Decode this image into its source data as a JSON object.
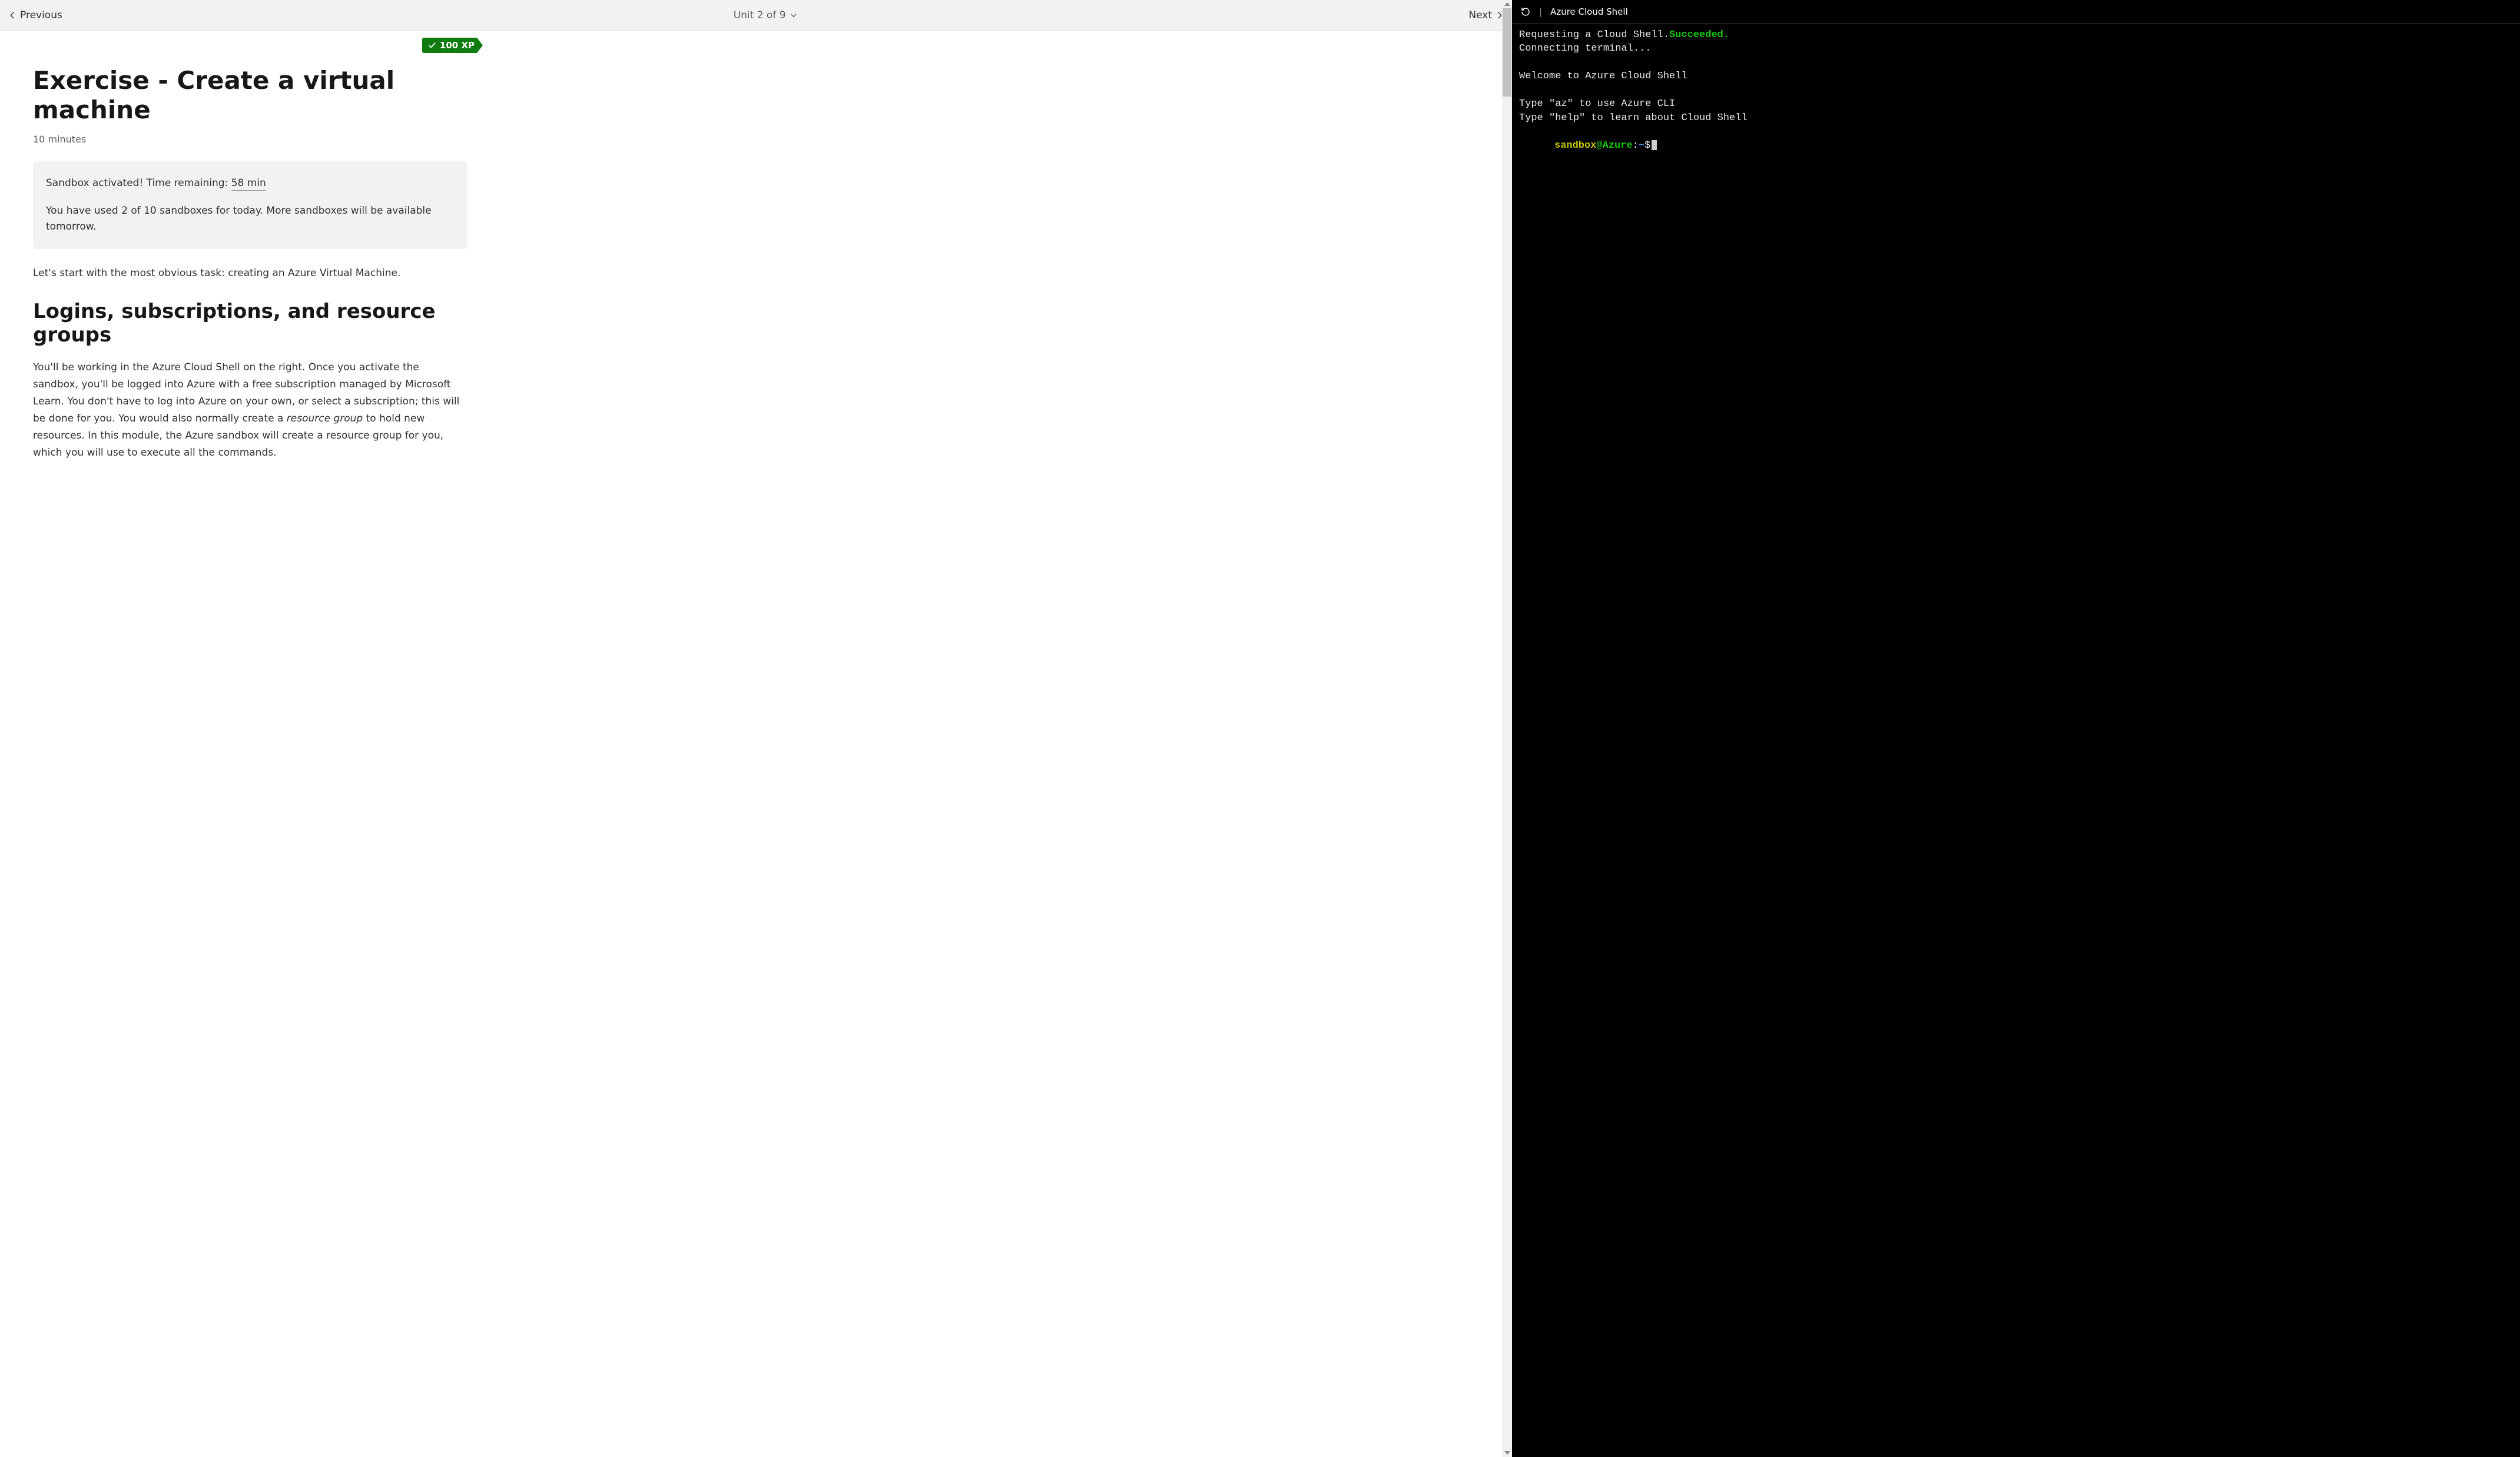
{
  "nav": {
    "previous": "Previous",
    "next": "Next",
    "unit_label": "Unit 2 of 9"
  },
  "xp": {
    "label": "100 XP"
  },
  "page": {
    "title": "Exercise - Create a virtual machine",
    "duration": "10 minutes"
  },
  "sandbox": {
    "activated_prefix": "Sandbox activated! Time remaining: ",
    "time_remaining": "58 min",
    "usage": "You have used 2 of 10 sandboxes for today. More sandboxes will be available tomorrow."
  },
  "intro_paragraph": "Let's start with the most obvious task: creating an Azure Virtual Machine.",
  "section_heading": "Logins, subscriptions, and resource groups",
  "section_body_pre": "You'll be working in the Azure Cloud Shell on the right. Once you activate the sandbox, you'll be logged into Azure with a free subscription managed by Microsoft Learn. You don't have to log into Azure on your own, or select a subscription; this will be done for you. You would also normally create a ",
  "section_body_italic": "resource group",
  "section_body_post": " to hold new resources. In this module, the Azure sandbox will create a resource group for you, which you will use to execute all the commands.",
  "shell": {
    "title": "Azure Cloud Shell",
    "line_request": "Requesting a Cloud Shell.",
    "line_succeeded": "Succeeded.",
    "line_connecting": "Connecting terminal...",
    "line_welcome": "Welcome to Azure Cloud Shell",
    "line_az": "Type \"az\" to use Azure CLI",
    "line_help": "Type \"help\" to learn about Cloud Shell",
    "prompt_user": "sandbox",
    "prompt_host": "@Azure",
    "prompt_sep": ":",
    "prompt_path": "~",
    "prompt_end": "$"
  }
}
